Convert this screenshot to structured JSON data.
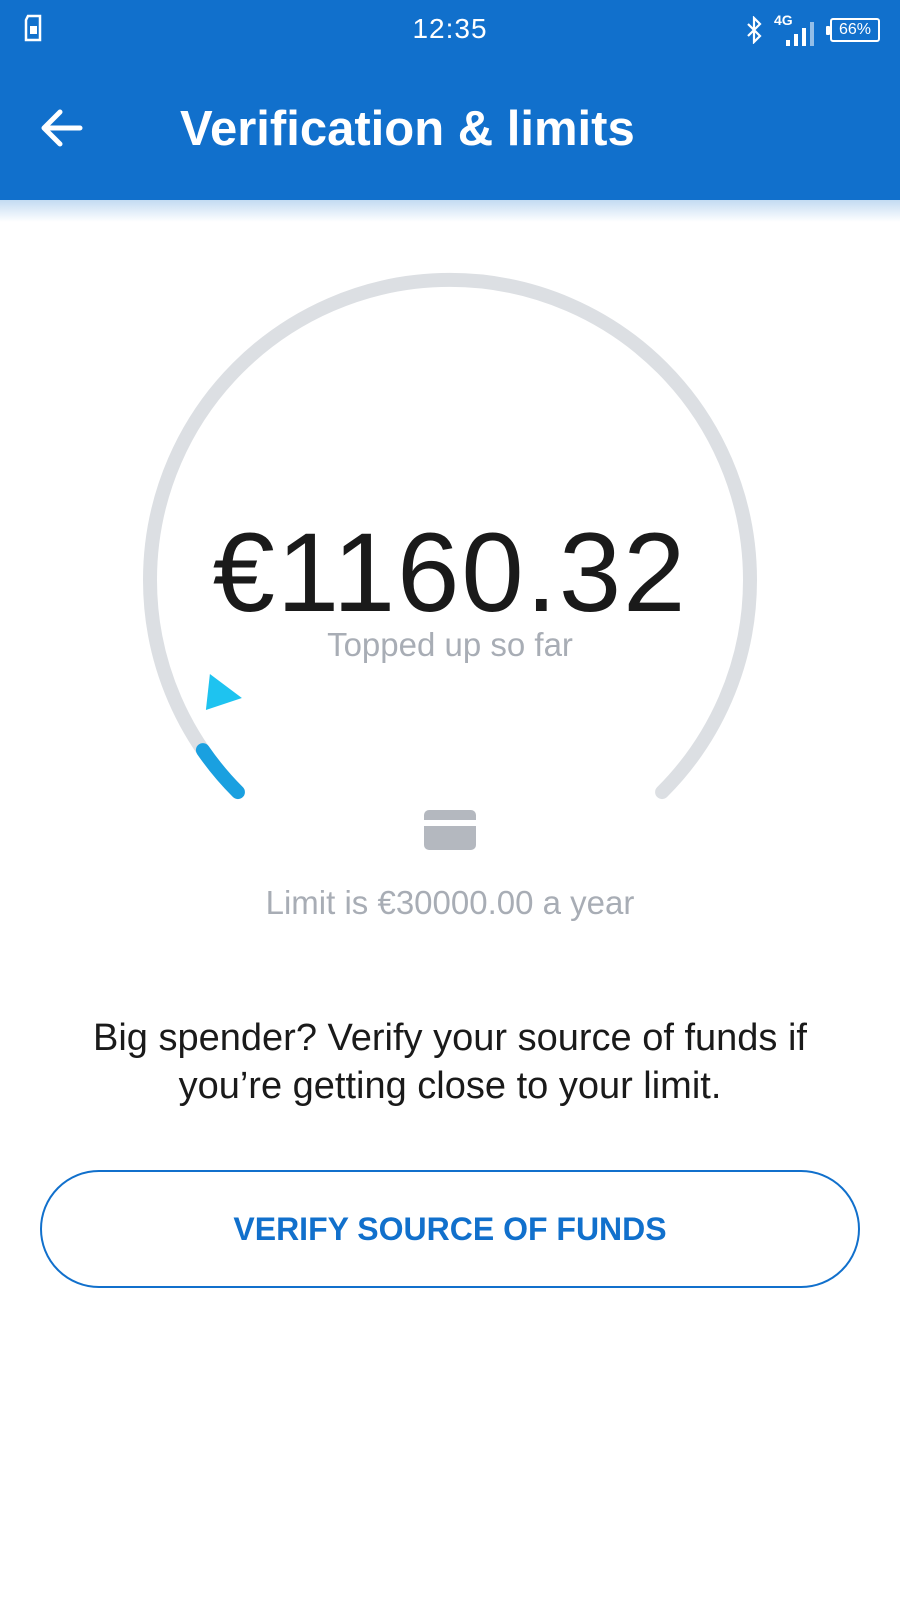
{
  "status_bar": {
    "time": "12:35",
    "network": "4G",
    "battery": "66%",
    "icons": [
      "sim-card-icon",
      "bluetooth-icon",
      "signal-icon",
      "battery-icon"
    ]
  },
  "header": {
    "title": "Verification & limits",
    "back_icon": "back-arrow-icon",
    "background_color": "#1170cc"
  },
  "gauge": {
    "amount": "€1160.32",
    "caption": "Topped up so far",
    "limit_text": "Limit is €30000.00 a year",
    "progress_fraction": 0.0387,
    "track_color": "#dcdfe3",
    "progress_color": "#1aa0e0",
    "marker_color": "#1ec3f0",
    "center_icon": "card-icon"
  },
  "info": {
    "text": "Big spender? Verify your source of funds if you’re getting close to your limit."
  },
  "actions": {
    "verify_label": "VERIFY SOURCE OF FUNDS",
    "accent_color": "#1170cc"
  }
}
